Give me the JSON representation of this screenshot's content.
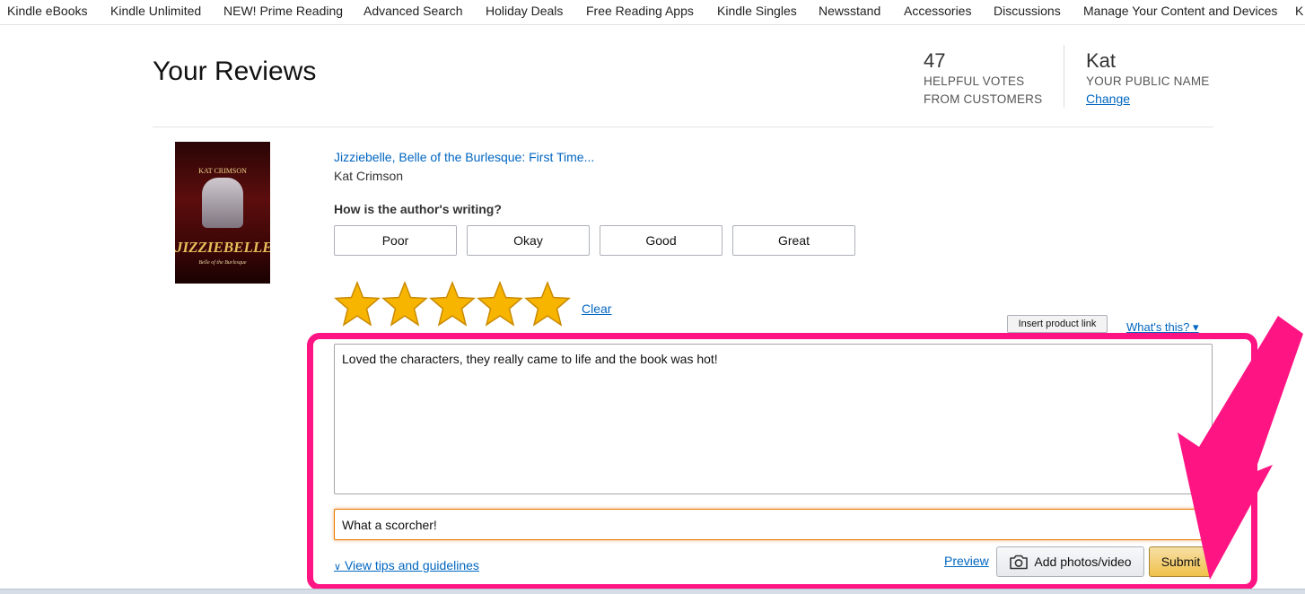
{
  "nav": {
    "items": [
      "Kindle eBooks",
      "Kindle Unlimited",
      "NEW! Prime Reading",
      "Advanced Search",
      "Holiday Deals",
      "Free Reading Apps",
      "Kindle Singles",
      "Newsstand",
      "Accessories",
      "Discussions",
      "Manage Your Content and Devices",
      "K"
    ]
  },
  "header": {
    "title": "Your Reviews",
    "helpful_votes": "47",
    "helpful_label_1": "HELPFUL VOTES",
    "helpful_label_2": "FROM CUSTOMERS",
    "public_name": "Kat",
    "public_name_label": "YOUR PUBLIC NAME",
    "change_label": "Change"
  },
  "book": {
    "cover_author": "KAT CRIMSON",
    "cover_title": "JIZZIEBELLE",
    "cover_subtitle": "Belle of the Burlesque",
    "title": "Jizziebelle, Belle of the Burlesque: First Time...",
    "author": "Kat Crimson"
  },
  "review": {
    "question": "How is the author's writing?",
    "options": [
      "Poor",
      "Okay",
      "Good",
      "Great"
    ],
    "rating": 5,
    "max_rating": 5,
    "clear_label": "Clear",
    "insert_link_label": "Insert product link",
    "whats_this_label": "What's this?",
    "body_text": "Loved the characters, they really came to life and the book was hot!",
    "headline_text": "What a scorcher!",
    "tips_label": "View tips and guidelines",
    "preview_label": "Preview",
    "add_media_label": "Add photos/video",
    "submit_label": "Submit"
  },
  "colors": {
    "link": "#0066c0",
    "star": "#f7b500",
    "annotation": "#ff1483",
    "submit": "#f0c14b"
  }
}
